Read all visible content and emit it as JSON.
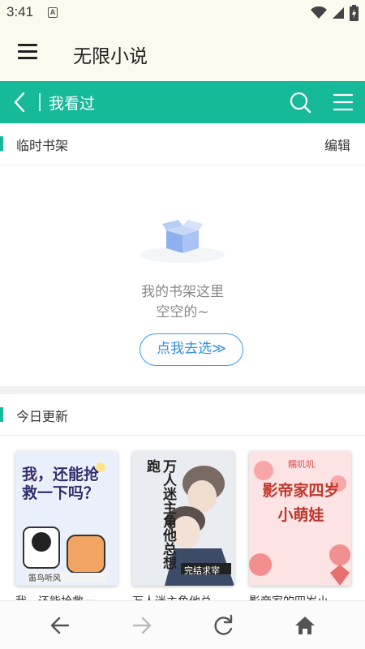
{
  "status_bar": {
    "time": "3:41",
    "notification_icon": "a-icon",
    "icons": [
      "wifi-icon",
      "signal-icon",
      "battery-icon"
    ]
  },
  "app_bar": {
    "title": "无限小说",
    "menu_icon": "hamburger-menu-icon"
  },
  "header": {
    "title": "我看过",
    "back_icon": "chevron-left-icon",
    "search_icon": "search-icon",
    "list_icon": "list-icon",
    "color": "#17b99b"
  },
  "temp_shelf": {
    "title": "临时书架",
    "edit_label": "编辑",
    "empty_line1": "我的书架这里",
    "empty_line2": "空空的~",
    "go_button": "点我去选≫",
    "empty_icon": "empty-box-icon"
  },
  "today_updates": {
    "title": "今日更新",
    "books": [
      {
        "name": "我，还能抢救一",
        "cover_text": "我，还能抢救一下吗？",
        "cover_author": "笛鸟听风",
        "cover_color": "#eaf0fb"
      },
      {
        "name": "万人迷主角他总",
        "cover_text": "万人迷主角他总想跑",
        "cover_badge": "完结求宰",
        "cover_color": "#e9edf2"
      },
      {
        "name": "影帝家的四岁小",
        "cover_text": "影帝家四岁小萌娃",
        "cover_subtext": "糯叽叽",
        "cover_color": "#fde3e3"
      }
    ]
  },
  "bottom_bar": {
    "icons": [
      "back-arrow-icon",
      "forward-arrow-icon",
      "refresh-icon",
      "home-icon"
    ]
  }
}
